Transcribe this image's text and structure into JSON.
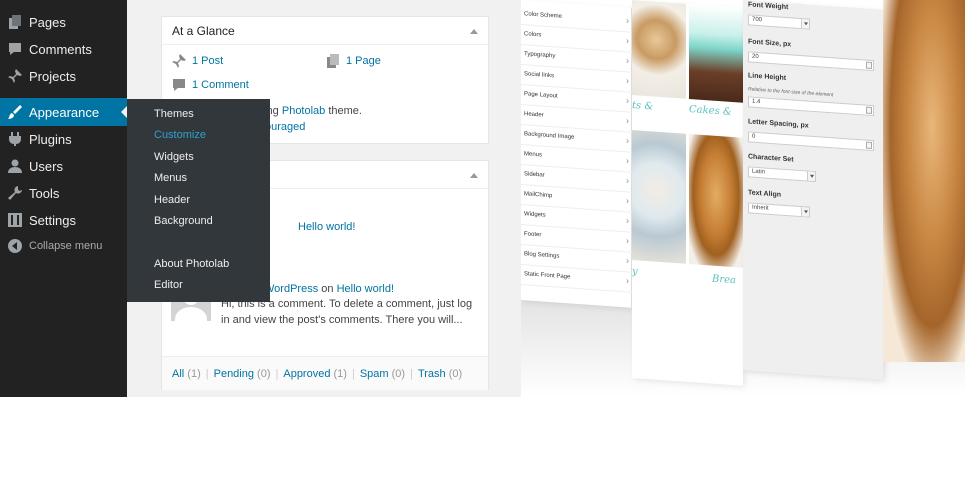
{
  "sidebar": {
    "items": [
      {
        "label": "Pages",
        "icon": "pages-icon"
      },
      {
        "label": "Comments",
        "icon": "comments-icon"
      },
      {
        "label": "Projects",
        "icon": "projects-icon"
      },
      {
        "label": "Appearance",
        "icon": "appearance-icon",
        "active": true
      },
      {
        "label": "Plugins",
        "icon": "plugins-icon"
      },
      {
        "label": "Users",
        "icon": "users-icon"
      },
      {
        "label": "Tools",
        "icon": "tools-icon"
      },
      {
        "label": "Settings",
        "icon": "settings-icon"
      },
      {
        "label": "Collapse menu",
        "icon": "collapse-icon"
      }
    ]
  },
  "flyout": {
    "items": [
      {
        "label": "Themes"
      },
      {
        "label": "Customize",
        "current": true
      },
      {
        "label": "Widgets"
      },
      {
        "label": "Menus"
      },
      {
        "label": "Header"
      },
      {
        "label": "Background"
      },
      {
        "label": "About Photolab"
      },
      {
        "label": "Editor"
      }
    ]
  },
  "glance": {
    "title": "At a Glance",
    "posts": "1 Post",
    "pages": "1 Page",
    "comments": "1 Comment",
    "theme_prefix": "ning ",
    "theme_name": "Photolab",
    "theme_suffix": " theme.",
    "discouraged": "ouraged"
  },
  "activity": {
    "recent_post_link": "Hello world!",
    "comment_author": "WordPress",
    "comment_on": " on ",
    "comment_post": "Hello world!",
    "comment_line1": "Hi, this is a comment. To delete a comment, just log",
    "comment_line2": "in and view the post's comments. There you will...",
    "filters": [
      {
        "label": "All",
        "count": "(1)"
      },
      {
        "label": "Pending",
        "count": "(0)"
      },
      {
        "label": "Approved",
        "count": "(1)"
      },
      {
        "label": "Spam",
        "count": "(0)"
      },
      {
        "label": "Trash",
        "count": "(0)"
      }
    ]
  },
  "customizer": {
    "panels": [
      "Color Scheme",
      "Colors",
      "Typography",
      "Social links",
      "Page Layout",
      "Header",
      "Background Image",
      "Menus",
      "Sidebar",
      "MailChimp",
      "Widgets",
      "Footer",
      "Blog Settings",
      "Static Front Page"
    ],
    "captions": [
      "ts &",
      "Cakes &",
      "y",
      "Brea"
    ],
    "font_weight_label": "Font Weight",
    "font_weight_value": "700",
    "font_size_label": "Font Size, px",
    "font_size_value": "20",
    "line_height_label": "Line Height",
    "line_height_hint": "Relative to the font-size of the element",
    "line_height_value": "1.4",
    "letter_spacing_label": "Letter Spacing, px",
    "letter_spacing_value": "0",
    "charset_label": "Character Set",
    "charset_value": "Latin",
    "text_align_label": "Text Align",
    "text_align_value": "Inherit"
  },
  "colors": {
    "admin_bar": "#222222",
    "active_menu": "#0074a2",
    "link": "#0074a2",
    "accent_caption": "#5bc0be"
  }
}
